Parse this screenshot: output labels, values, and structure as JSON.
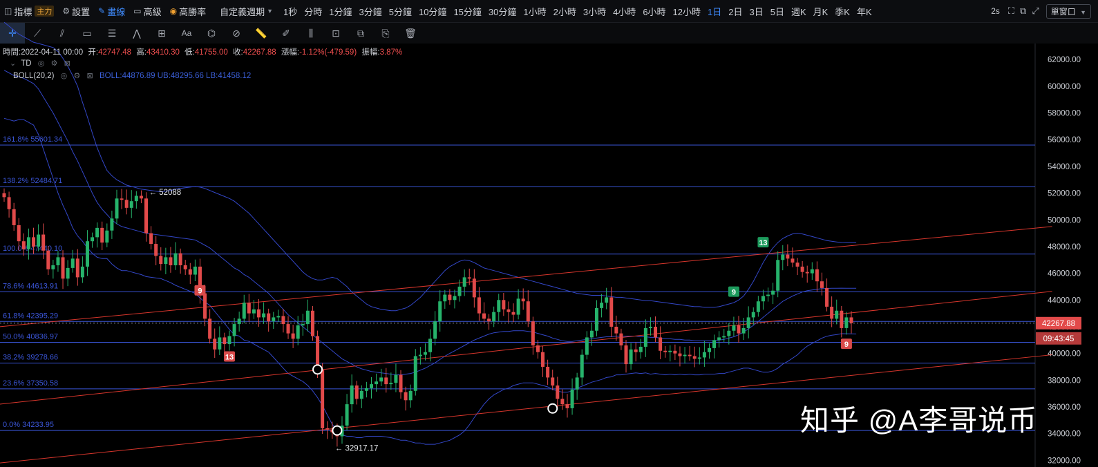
{
  "toolbar": {
    "indicators_label": "指標",
    "indicators_tag": "主力",
    "settings_label": "設置",
    "draw_label": "畫線",
    "advanced_label": "高級",
    "high_win_label": "高勝率",
    "custom_period_label": "自定義週期",
    "intervals": [
      "1秒",
      "分時",
      "1分鐘",
      "3分鐘",
      "5分鐘",
      "10分鐘",
      "15分鐘",
      "30分鐘",
      "1小時",
      "2小時",
      "3小時",
      "4小時",
      "6小時",
      "12小時",
      "1日",
      "2日",
      "3日",
      "5日",
      "週K",
      "月K",
      "季K",
      "年K"
    ],
    "selected_interval": "1日",
    "refresh_label": "2s",
    "window_label": "單窗口"
  },
  "drawing_tools": [
    "crosshair-icon",
    "trendline-icon",
    "parallel-channel-icon",
    "rectangle-icon",
    "fib-levels-icon",
    "wave-icon",
    "measure-icon",
    "text-icon",
    "magnet-icon",
    "lock-magnet-icon",
    "ruler-icon",
    "brush-icon",
    "candle-compare-icon",
    "lock-icon",
    "copy-icon",
    "note-icon",
    "trash-icon"
  ],
  "info": {
    "time_label": "時間:",
    "time_value": "2022-04-11 00:00",
    "open_label": "开:",
    "open_value": "42747.48",
    "high_label": "高:",
    "high_value": "43410.30",
    "low_label": "低:",
    "low_value": "41755.00",
    "close_label": "收:",
    "close_value": "42267.88",
    "change_label": "漲幅:",
    "change_value": "-1.12%(-479.59)",
    "amplitude_label": "振幅:",
    "amplitude_value": "3.87%"
  },
  "indicators": {
    "td_label": "TD",
    "boll_label": "BOLL(20,2)",
    "boll_values": "BOLL:44876.89  UB:48295.66  LB:41458.12"
  },
  "watermark": "知乎 @A李哥说币",
  "colors": {
    "up": "#26b36b",
    "down": "#e24a4a",
    "boll": "#3347c8",
    "fib": "#3a55d6",
    "channel": "#d8362c",
    "axis_text": "#c9ccd2",
    "price_tag": "#e24a4a"
  },
  "chart_data": {
    "type": "candlestick",
    "ylim": [
      31500,
      63200
    ],
    "y_ticks": [
      32000,
      34000,
      36000,
      38000,
      40000,
      42000,
      44000,
      46000,
      48000,
      50000,
      52000,
      54000,
      56000,
      58000,
      60000,
      62000
    ],
    "y_tick_labels": [
      "32000.00",
      "34000.00",
      "36000.00",
      "38000.00",
      "40000.00",
      "42000.00",
      "44000.00",
      "46000.00",
      "48000.00",
      "50000.00",
      "52000.00",
      "54000.00",
      "56000.00",
      "58000.00",
      "60000.00",
      "62000.00"
    ],
    "last_price": 42267.88,
    "last_price_label": "42267.88",
    "countdown_label": "09:43:45",
    "fib_levels": [
      {
        "label": "161.8% 55601.34",
        "price": 55601.34
      },
      {
        "label": "138.2% 52484.71",
        "price": 52484.71
      },
      {
        "label": "100.0% 47440.10",
        "price": 47440.1
      },
      {
        "label": "78.6% 44613.91",
        "price": 44613.91
      },
      {
        "label": "61.8% 42395.29",
        "price": 42395.29
      },
      {
        "label": "50.0% 40836.97",
        "price": 40836.97
      },
      {
        "label": "38.2% 39278.66",
        "price": 39278.66
      },
      {
        "label": "23.6% 37350.58",
        "price": 37350.58
      },
      {
        "label": "0.0% 34233.95",
        "price": 34233.95
      }
    ],
    "annotations": [
      {
        "label": "← 52088",
        "price": 52088,
        "bar": 29
      },
      {
        "label": "← 32917.17",
        "price": 32917.17,
        "bar": 67
      }
    ],
    "td_markers": [
      {
        "label": "9",
        "bar": 40,
        "price": 44700,
        "color": "down"
      },
      {
        "label": "13",
        "bar": 46,
        "price": 39750,
        "color": "down"
      },
      {
        "label": "13",
        "bar": 155,
        "price": 48300,
        "color": "up"
      },
      {
        "label": "9",
        "bar": 149,
        "price": 44600,
        "color": "up"
      },
      {
        "label": "9",
        "bar": 172,
        "price": 40700,
        "color": "down"
      }
    ],
    "pivot_circles": [
      {
        "bar": 64,
        "price": 38800
      },
      {
        "bar": 68,
        "price": 34233
      },
      {
        "bar": 112,
        "price": 35880
      }
    ],
    "channel_lines": [
      {
        "bar_a": -1,
        "price_a": 42000,
        "bar_b": 214,
        "price_b": 49500
      },
      {
        "bar_a": -1,
        "price_a": 36200,
        "bar_b": 214,
        "price_b": 44650
      },
      {
        "bar_a": -1,
        "price_a": 31800,
        "bar_b": 214,
        "price_b": 39900
      }
    ],
    "closes": [
      51700,
      50800,
      49600,
      48400,
      47800,
      48700,
      48000,
      48900,
      47700,
      46300,
      46600,
      47200,
      45600,
      46400,
      47100,
      45700,
      46500,
      48400,
      48700,
      49400,
      48300,
      49200,
      50100,
      51600,
      51500,
      50900,
      51400,
      51800,
      51600,
      49000,
      48200,
      47300,
      46700,
      47200,
      46600,
      47500,
      46600,
      46300,
      45900,
      46500,
      44500,
      42600,
      41100,
      40300,
      41200,
      40700,
      41300,
      42200,
      42600,
      43800,
      43000,
      43300,
      42700,
      43000,
      42400,
      42700,
      42800,
      42200,
      41500,
      41100,
      42100,
      42200,
      43200,
      41300,
      38800,
      34400,
      34300,
      34100,
      33800,
      34600,
      36200,
      37600,
      36600,
      37200,
      37400,
      37700,
      37900,
      38200,
      37700,
      37800,
      38400,
      37100,
      36500,
      37200,
      39800,
      39900,
      40100,
      41100,
      42400,
      43900,
      44400,
      44000,
      44300,
      45000,
      45700,
      45600,
      44200,
      43000,
      42600,
      42400,
      43100,
      44000,
      43300,
      43100,
      42900,
      44100,
      43900,
      42400,
      40600,
      40100,
      39000,
      38200,
      37600,
      36600,
      36200,
      35900,
      37300,
      38200,
      39900,
      41200,
      41700,
      43400,
      43800,
      44200,
      42000,
      41500,
      40600,
      39200,
      40300,
      40100,
      40500,
      41900,
      42000,
      41200,
      40200,
      40100,
      40200,
      40000,
      39800,
      39900,
      39800,
      39600,
      39700,
      40100,
      40400,
      41000,
      41200,
      41300,
      41700,
      42100,
      41500,
      41900,
      42700,
      43100,
      43900,
      44300,
      44400,
      44700,
      47000,
      47400,
      47100,
      46800,
      46500,
      46100,
      46000,
      46300,
      45400,
      44900,
      43500,
      42600,
      43200,
      41900,
      42700,
      42267.88
    ],
    "boll_mid": [
      61200,
      61000,
      60800,
      60700,
      60600,
      60400,
      60200,
      59800,
      59200,
      58600,
      58000,
      57300,
      56600,
      55900,
      55100,
      54400,
      53600,
      52800,
      52000,
      51300,
      50800,
      50400,
      50000,
      49700,
      49500,
      49400,
      49300,
      49200,
      49100,
      49000,
      48950,
      48900,
      48850,
      48800,
      48750,
      48700,
      48650,
      48600,
      48550,
      48500,
      48300,
      48100,
      47900,
      47600,
      47300,
      47000,
      46700,
      46400,
      46200,
      45900,
      45700,
      45400,
      45100,
      44800,
      44500,
      44100,
      43700,
      43300,
      42900,
      42600,
      42300,
      42000,
      41700,
      41400,
      41100,
      40800,
      40500,
      40200,
      39900,
      39600,
      39400,
      39200,
      39000,
      38850,
      38750,
      38650,
      38600,
      38550,
      38500,
      38450,
      38400,
      38400,
      38450,
      38500,
      38600,
      38750,
      38900,
      39100,
      39300,
      39550,
      39800,
      40000,
      40200,
      40400,
      40600,
      40800,
      41000,
      41150,
      41300,
      41450,
      41550,
      41600,
      41650,
      41650,
      41700,
      41700,
      41700,
      41650,
      41600,
      41500,
      41400,
      41300,
      41150,
      41050,
      40950,
      40900,
      40900,
      40950,
      41000,
      41050,
      41100,
      41150,
      41200,
      41250,
      41250,
      41300,
      41300,
      41300,
      41300,
      41300,
      41250,
      41250,
      41200,
      41200,
      41150,
      41100,
      41100,
      41050,
      41050,
      41000,
      41000,
      40950,
      40950,
      40950,
      40950,
      40950,
      41000,
      41050,
      41150,
      41250,
      41400,
      41600,
      41850,
      42100,
      42400,
      42700,
      43000,
      43300,
      43600,
      43900,
      44100,
      44300,
      44450,
      44600,
      44700,
      44750,
      44800,
      44850,
      44870,
      44880,
      44880,
      44890,
      44885,
      44880,
      44877
    ],
    "boll_upper": [
      64800,
      64500,
      64200,
      63900,
      63700,
      63500,
      63300,
      63200,
      63100,
      63000,
      62900,
      62600,
      62100,
      61500,
      60800,
      60000,
      58800,
      57700,
      56500,
      55400,
      54500,
      53700,
      53300,
      53000,
      52800,
      52600,
      52500,
      52400,
      52300,
      52250,
      52200,
      52150,
      52100,
      52150,
      52200,
      52300,
      52350,
      52400,
      52450,
      52500,
      52450,
      52350,
      52200,
      52050,
      51900,
      51750,
      51600,
      51400,
      51100,
      50800,
      50500,
      50100,
      49700,
      49300,
      48900,
      48500,
      48100,
      47700,
      47300,
      46900,
      46500,
      46100,
      45800,
      45600,
      45500,
      45500,
      45600,
      45700,
      45600,
      45300,
      45000,
      44600,
      44300,
      44000,
      43700,
      43500,
      43400,
      43300,
      43250,
      43200,
      43200,
      43300,
      43400,
      43600,
      43900,
      44200,
      44600,
      45000,
      45400,
      45800,
      46200,
      46500,
      46700,
      46900,
      47000,
      46950,
      46800,
      46600,
      46400,
      46300,
      46200,
      46100,
      46000,
      45900,
      45800,
      45700,
      45600,
      45500,
      45400,
      45300,
      45200,
      45100,
      45000,
      44900,
      44800,
      44700,
      44600,
      44500,
      44450,
      44400,
      44350,
      44350,
      44350,
      44300,
      44250,
      44200,
      44200,
      44150,
      44100,
      44050,
      44000,
      43950,
      43950,
      43900,
      43850,
      43800,
      43750,
      43700,
      43650,
      43600,
      43550,
      43500,
      43500,
      43450,
      43450,
      43450,
      43500,
      43600,
      43700,
      43800,
      44000,
      44300,
      44800,
      45400,
      46100,
      46800,
      47400,
      47900,
      48300,
      48600,
      48800,
      48950,
      49000,
      48950,
      48850,
      48750,
      48650,
      48550,
      48450,
      48400,
      48350,
      48300,
      48295,
      48295,
      48295
    ],
    "boll_lower": [
      57600,
      57500,
      57400,
      57500,
      57500,
      57300,
      57100,
      56400,
      55300,
      54200,
      53100,
      52000,
      51100,
      50300,
      49400,
      48800,
      48400,
      47900,
      47500,
      47200,
      47100,
      47100,
      46700,
      46400,
      46200,
      46200,
      46100,
      46000,
      45900,
      45750,
      45700,
      45650,
      45600,
      45450,
      45300,
      45100,
      44950,
      44800,
      44650,
      44500,
      44150,
      43850,
      43600,
      43150,
      42700,
      42250,
      41800,
      41400,
      41300,
      41000,
      40900,
      40700,
      40500,
      40300,
      40100,
      39700,
      39300,
      38900,
      38500,
      38300,
      38100,
      37900,
      37600,
      37200,
      36700,
      36100,
      35400,
      34700,
      34200,
      33900,
      33800,
      33800,
      33700,
      33700,
      33800,
      33800,
      33800,
      33800,
      33750,
      33700,
      33600,
      33500,
      33500,
      33400,
      33300,
      33300,
      33200,
      33200,
      33200,
      33300,
      33400,
      33500,
      33700,
      33900,
      34200,
      34650,
      35200,
      35700,
      36200,
      36600,
      36900,
      37100,
      37300,
      37400,
      37600,
      37700,
      37800,
      37800,
      37800,
      37700,
      37600,
      37500,
      37300,
      37200,
      37100,
      37100,
      37200,
      37400,
      37550,
      37700,
      37850,
      37950,
      38050,
      38200,
      38250,
      38400,
      38400,
      38450,
      38500,
      38550,
      38500,
      38550,
      38450,
      38500,
      38450,
      38400,
      38450,
      38400,
      38450,
      38400,
      38450,
      38400,
      38400,
      38450,
      38450,
      38450,
      38500,
      38500,
      38600,
      38700,
      38800,
      38900,
      38900,
      38800,
      38700,
      38600,
      38600,
      38700,
      38900,
      39200,
      39400,
      39650,
      39900,
      40250,
      40550,
      40750,
      40950,
      41150,
      41290,
      41360,
      41410,
      41480,
      41475,
      41465,
      41458
    ]
  }
}
